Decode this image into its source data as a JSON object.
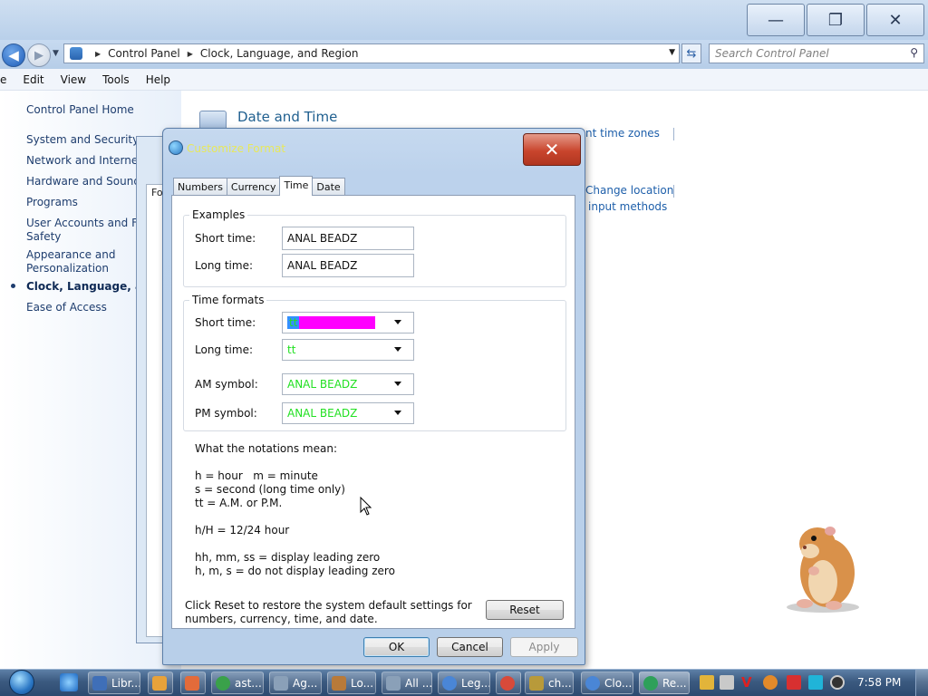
{
  "explorer": {
    "breadcrumb": [
      "Control Panel",
      "Clock, Language, and Region"
    ],
    "search_placeholder": "Search Control Panel",
    "menu": [
      "e",
      "Edit",
      "View",
      "Tools",
      "Help"
    ],
    "left_nav": {
      "home": "Control Panel Home",
      "items": [
        {
          "label": "System and Security"
        },
        {
          "label": "Network and Internet"
        },
        {
          "label": "Hardware and Sound"
        },
        {
          "label": "Programs"
        },
        {
          "label": "User Accounts and Fan",
          "label2": "Safety"
        },
        {
          "label": "Appearance and",
          "label2": "Personalization"
        },
        {
          "label": "Clock, Language, and I"
        },
        {
          "label": "Ease of Access"
        }
      ]
    },
    "main": {
      "section_title": "Date and Time",
      "links": [
        "nt time zones",
        "Change location",
        "input methods"
      ]
    },
    "bg_dialog_tab": "Fo"
  },
  "dialog": {
    "title": "Customize Format",
    "tabs": [
      "Numbers",
      "Currency",
      "Time",
      "Date"
    ],
    "active_tab": "Time",
    "examples": {
      "title": "Examples",
      "short_label": "Short time:",
      "short_value": "ANAL BEADZ",
      "long_label": "Long time:",
      "long_value": "ANAL BEADZ"
    },
    "formats": {
      "title": "Time formats",
      "short_label": "Short time:",
      "short_value": "tt",
      "long_label": "Long time:",
      "long_value": "tt",
      "am_label": "AM symbol:",
      "am_value": "ANAL BEADZ",
      "pm_label": "PM symbol:",
      "pm_value": "ANAL BEADZ"
    },
    "notations": {
      "heading": "What the notations mean:",
      "l1": "h = hour   m = minute",
      "l2": "s = second (long time only)",
      "l3": "tt = A.M. or P.M.",
      "l4": "h/H = 12/24 hour",
      "l5": "hh, mm, ss = display leading zero",
      "l6": "h, m, s = do not display leading zero"
    },
    "reset_text_1": "Click Reset to restore the system default settings for",
    "reset_text_2": "numbers, currency, time, and date.",
    "reset_label": "Reset",
    "ok_label": "OK",
    "cancel_label": "Cancel",
    "apply_label": "Apply"
  },
  "taskbar": {
    "items": [
      {
        "label": "Libr...",
        "color": "#3f6fb8"
      },
      {
        "label": "",
        "color": "#e7a23a"
      },
      {
        "label": "",
        "color": "#e36b3a"
      },
      {
        "label": "ast...",
        "color": "#3aa14a"
      },
      {
        "label": "Ag...",
        "color": "#8aa0b8"
      },
      {
        "label": "Lo...",
        "color": "#b87a3a"
      },
      {
        "label": "All ...",
        "color": "#8aa0b8"
      },
      {
        "label": "Leg...",
        "color": "#4a86d6"
      },
      {
        "label": "",
        "color": "#d84a3a"
      },
      {
        "label": "ch...",
        "color": "#b89a3a"
      },
      {
        "label": "Clo...",
        "color": "#4a86d6"
      },
      {
        "label": "Re...",
        "color": "#2ea05a"
      }
    ],
    "clock": "7:58 PM"
  },
  "colors": {
    "format_text": "#22e022",
    "selection_magenta": "#ff00ff",
    "link": "#1e5faa"
  }
}
